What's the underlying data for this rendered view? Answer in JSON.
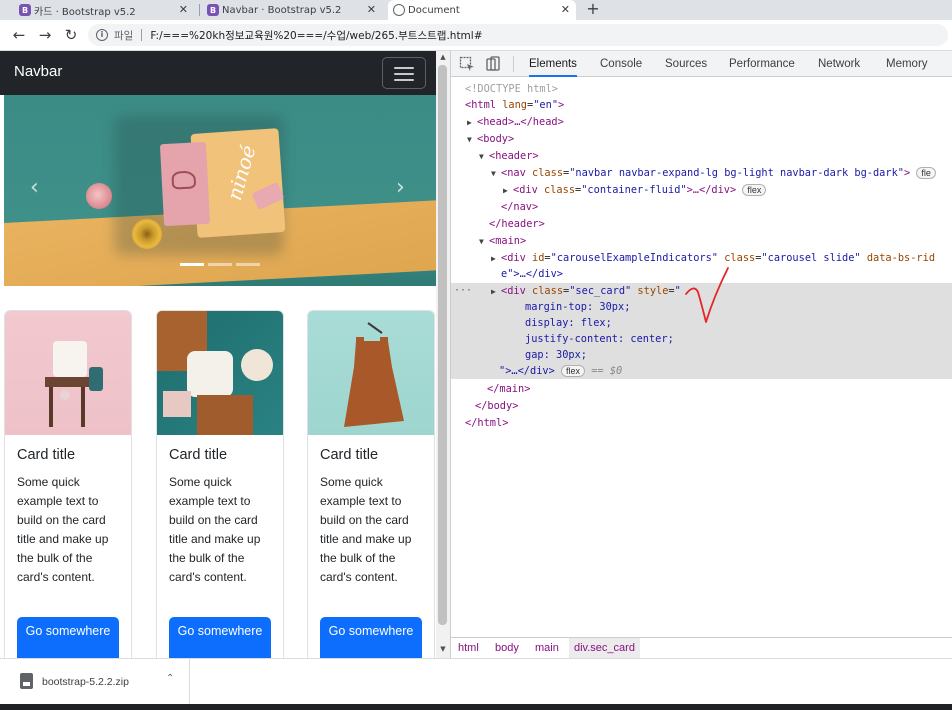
{
  "browser": {
    "tabs": [
      {
        "label": "카드 · Bootstrap v5.2",
        "favicon": "B"
      },
      {
        "label": "Navbar · Bootstrap v5.2",
        "favicon": "B"
      },
      {
        "label": "Document",
        "favicon": "globe"
      }
    ],
    "close_glyph": "✕",
    "new_tab_glyph": "+",
    "nav": {
      "back": "←",
      "forward": "→",
      "reload": "↻"
    },
    "address": {
      "scheme": "파일",
      "url": "F:/===%20kh정보교육원%20===/수업/web/265.부트스트랩.html#"
    }
  },
  "page": {
    "navbar": {
      "brand": "Navbar"
    },
    "carousel": {
      "prev": "‹",
      "next": "›",
      "slide_count": 3,
      "active_slide": 1,
      "book_text": "ninoé"
    },
    "cards": [
      {
        "title": "Card title",
        "text": "Some quick example text to build on the card title and make up the bulk of the card's content.",
        "button": "Go somewhere"
      },
      {
        "title": "Card title",
        "text": "Some quick example text to build on the card title and make up the bulk of the card's content.",
        "button": "Go somewhere"
      },
      {
        "title": "Card title",
        "text": "Some quick example text to build on the card title and make up the bulk of the card's content.",
        "button": "Go somewhere"
      }
    ]
  },
  "devtools": {
    "tabs": [
      "Elements",
      "Console",
      "Sources",
      "Performance",
      "Network",
      "Memory"
    ],
    "active_tab": "Elements",
    "lines": {
      "doctype": "<!DOCTYPE html>",
      "html_open_tag": "<html",
      "html_lang_attr": "lang",
      "html_lang_val": "\"en\"",
      "head": "<head>…</head>",
      "body_open": "<body>",
      "header_open": "<header>",
      "nav_tag": "<nav",
      "nav_class_attr": "class",
      "nav_class_val": "\"navbar navbar-expand-lg bg-light navbar-dark bg-dark\"",
      "nav_end": ">",
      "nav_badge": "fle",
      "div_container_tag": "<div",
      "div_container_attr": "class",
      "div_container_val": "\"container-fluid\"",
      "div_container_end": ">…</div>",
      "div_container_badge": "flex",
      "nav_close": "</nav>",
      "header_close": "</header>",
      "main_open": "<main>",
      "carousel_tag": "<div",
      "carousel_id_attr": "id",
      "carousel_id_val": "\"carouselExampleIndicators\"",
      "carousel_class_attr": "class",
      "carousel_class_val": "\"carousel slide\"",
      "carousel_data_attr": "data-bs-rid",
      "carousel_cont": "e\">…</div>",
      "sec_tag": "<div",
      "sec_class_attr": "class",
      "sec_class_val": "\"sec_card\"",
      "sec_style_attr": "style",
      "sec_style_open": "\"",
      "style_1": "margin-top: 30px;",
      "style_2": "display: flex;",
      "style_3": "justify-content: center;",
      "style_4": "gap: 30px;",
      "sec_end": "\">…</div>",
      "sec_badge": "flex",
      "sec_dollar": "== $0",
      "main_close": "</main>",
      "body_close": "</body>",
      "html_close": "</html>",
      "dots": "···"
    },
    "breadcrumbs": [
      "html",
      "body",
      "main",
      "div.sec_card"
    ]
  },
  "downloads": {
    "file": "bootstrap-5.2.2.zip",
    "chevron": "⌃"
  }
}
